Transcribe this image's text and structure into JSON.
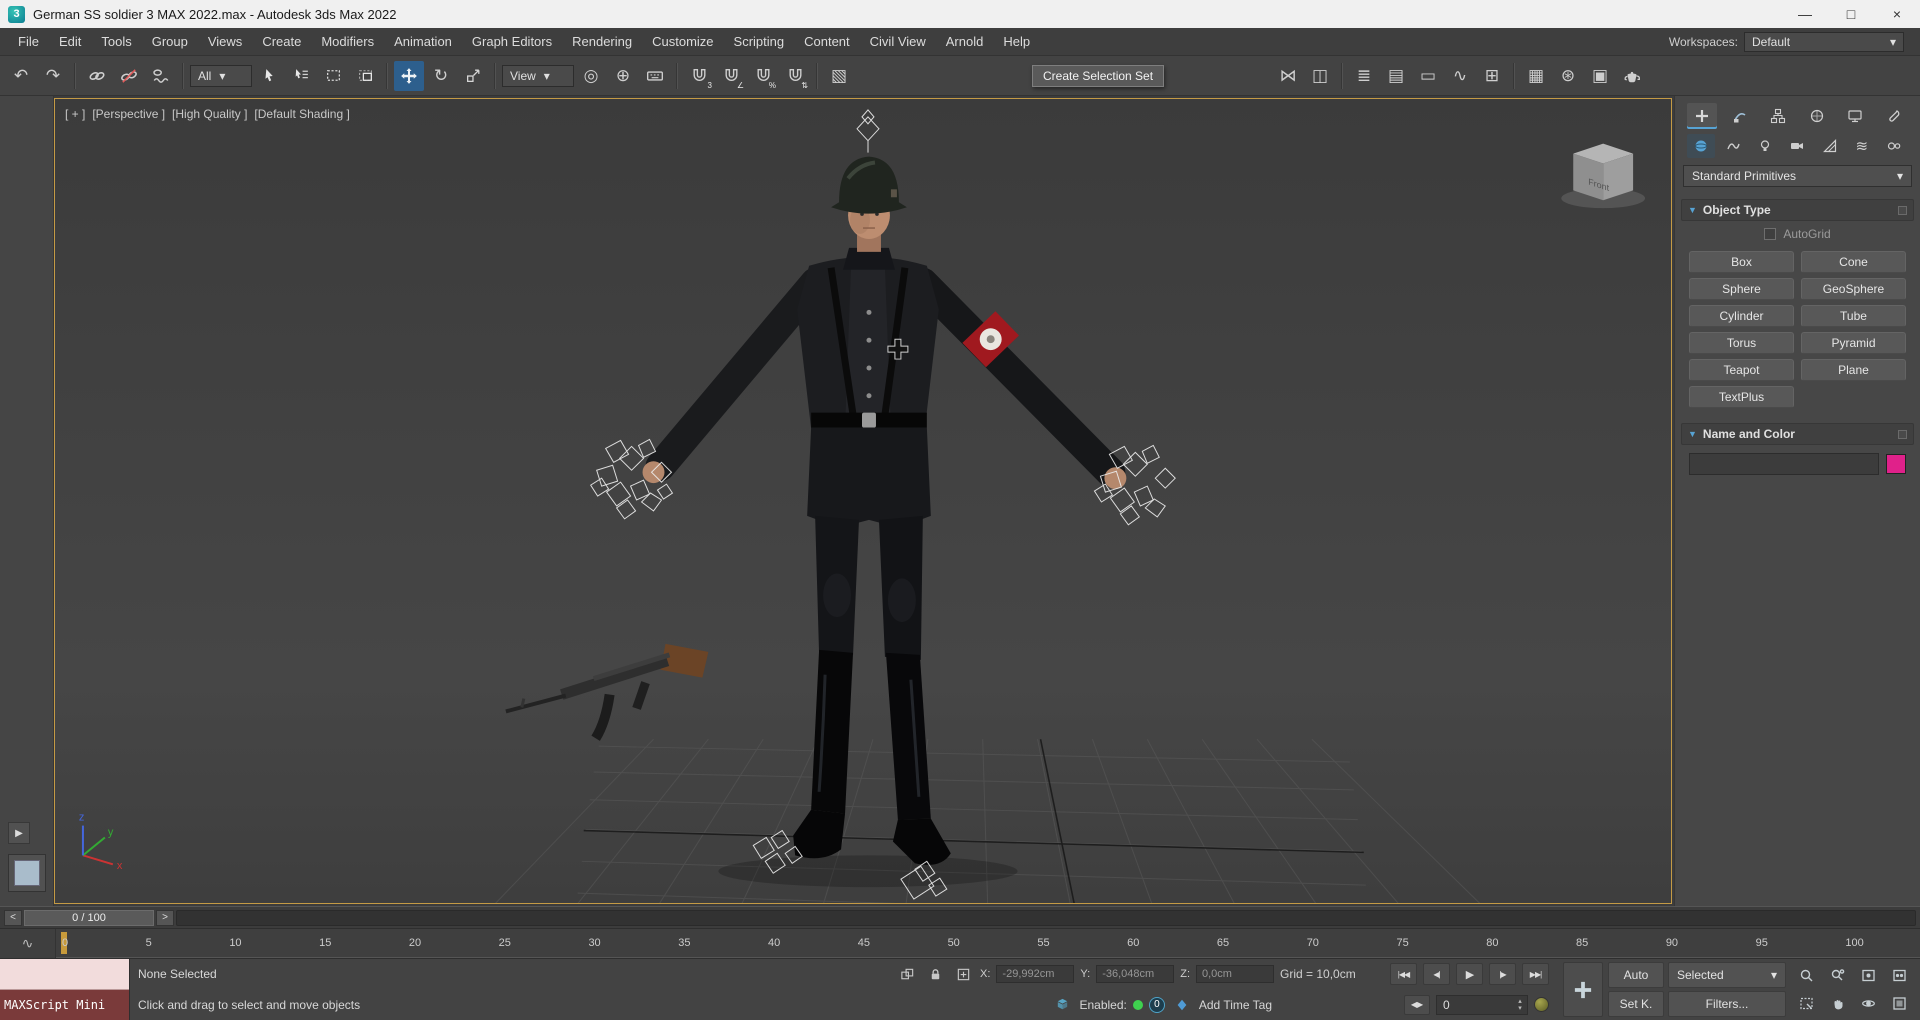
{
  "colors": {
    "accent": "#57a3d4",
    "tool-active-bg": "#2d5f8d",
    "viewport-border": "#c49a45",
    "armband-red": "#a0191f",
    "swatch-pink": "#e0218a",
    "status-green": "#3fd14f",
    "maxscript-pink": "#f2dcdc",
    "maxscript-maroon": "#7a3a3a",
    "timeline-marker": "#c79a3b"
  },
  "title_bar": {
    "logo": "3",
    "title": "German SS soldier 3 MAX 2022.max - Autodesk 3ds Max 2022",
    "minimize": "—",
    "maximize": "□",
    "close": "×"
  },
  "menu": {
    "items": [
      "File",
      "Edit",
      "Tools",
      "Group",
      "Views",
      "Create",
      "Modifiers",
      "Animation",
      "Graph Editors",
      "Rendering",
      "Customize",
      "Scripting",
      "Content",
      "Civil View",
      "Arnold",
      "Help"
    ],
    "workspaces_label": "Workspaces:",
    "workspace_value": "Default"
  },
  "icons": {
    "dropdown_arrow": "▾",
    "strip_arrow": "▶",
    "spin_up": "▴",
    "spin_down": "▾",
    "rollout_arrow": "▼"
  },
  "toolbar": {
    "selection_filter": "All",
    "ref_coord": "View",
    "tooltip": "Create Selection Set",
    "glyphs": {
      "undo": "↶",
      "redo": "↷",
      "rotate": "↻",
      "use_center": "◎",
      "manipulate": "⊕",
      "mirror": "⋈",
      "align": "◫",
      "scene_explorer": "≣",
      "layer_explorer": "▤",
      "ribbon": "▭",
      "curve_editor": "∿",
      "schematic": "⊞",
      "material_editor": "▦",
      "render_setup": "⊛",
      "rendered_frame": "▣",
      "named_sets": "▧",
      "snap_3d": "3",
      "snap_angle": "∠",
      "snap_percent": "%",
      "snap_spinner": "⇅"
    }
  },
  "viewport": {
    "label_segments": [
      "[ + ]",
      "[Perspective ]",
      "[High Quality ]",
      "[Default Shading ]"
    ],
    "viewcube_label": "Front",
    "axis": {
      "x": "x",
      "y": "y",
      "z": "z"
    }
  },
  "command_panel": {
    "category_dropdown": "Standard Primitives",
    "spacewarps_glyph": "≋",
    "object_type": {
      "title": "Object Type",
      "autogrid": "AutoGrid",
      "buttons": [
        "Box",
        "Cone",
        "Sphere",
        "GeoSphere",
        "Cylinder",
        "Tube",
        "Torus",
        "Pyramid",
        "Teapot",
        "Plane",
        "TextPlus"
      ]
    },
    "name_color": {
      "title": "Name and Color"
    }
  },
  "timeline": {
    "prev": "<",
    "next": ">",
    "frame_display": "0 / 100"
  },
  "trackbar": {
    "labels": [
      "0",
      "5",
      "10",
      "15",
      "20",
      "25",
      "30",
      "35",
      "40",
      "45",
      "50",
      "55",
      "60",
      "65",
      "70",
      "75",
      "80",
      "85",
      "90",
      "95",
      "100"
    ],
    "mini_curve_glyph": "∿"
  },
  "status_bar": {
    "maxscript_label": "MAXScript Mini",
    "prompt_line1": "None Selected",
    "prompt_line2": "Click and drag to select and move objects",
    "coord": {
      "x_label": "X:",
      "x_value": "-29,992cm",
      "y_label": "Y:",
      "y_value": "-36,048cm",
      "z_label": "Z:",
      "z_value": "0,0cm"
    },
    "grid_display": "Grid = 10,0cm",
    "playback": {
      "go_start": "|◀◀",
      "prev_frame": "◀|",
      "play": "▶",
      "next_frame": "|▶",
      "go_end": "▶▶|"
    },
    "key_mode_arrows": "◀▶",
    "frame_field": "0",
    "security": {
      "enabled_label": "Enabled:",
      "count": "0"
    },
    "add_time_tag": "Add Time Tag",
    "auto": "Auto",
    "selected_dropdown": "Selected",
    "set_key": "Set K.",
    "filters": "Filters..."
  }
}
